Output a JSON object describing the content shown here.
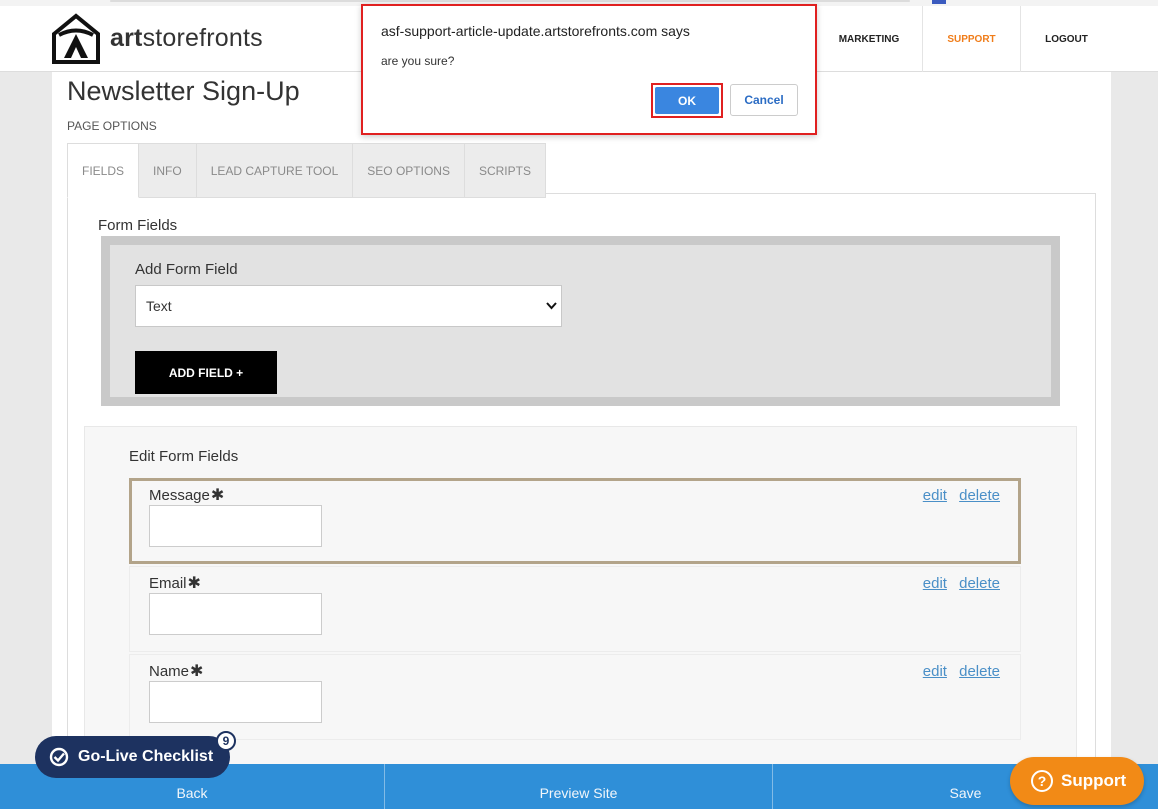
{
  "header": {
    "brand_bold": "art",
    "brand_rest": "storefronts",
    "nav": {
      "marketing": "MARKETING",
      "support": "SUPPORT",
      "logout": "LOGOUT"
    }
  },
  "page": {
    "title": "Newsletter Sign-Up",
    "options_label": "PAGE OPTIONS",
    "tabs": [
      "FIELDS",
      "INFO",
      "LEAD CAPTURE TOOL",
      "SEO OPTIONS",
      "SCRIPTS"
    ]
  },
  "form_fields": {
    "section_label": "Form Fields",
    "add_label": "Add Form Field",
    "select_value": "Text",
    "add_button": "ADD FIELD +"
  },
  "edit_fields": {
    "section_label": "Edit Form Fields",
    "rows": [
      {
        "name": "Message",
        "edit": "edit",
        "delete": "delete"
      },
      {
        "name": "Email",
        "edit": "edit",
        "delete": "delete"
      },
      {
        "name": "Name",
        "edit": "edit",
        "delete": "delete"
      }
    ],
    "required_mark": "✱"
  },
  "dialog": {
    "title": "asf-support-article-update.artstorefronts.com says",
    "message": "are you sure?",
    "ok": "OK",
    "cancel": "Cancel"
  },
  "bottom_bar": {
    "back": "Back",
    "preview": "Preview Site",
    "save": "Save"
  },
  "golive": {
    "label": "Go-Live Checklist",
    "badge": "9"
  },
  "support_widget": {
    "label": "Support",
    "icon_glyph": "?"
  },
  "colors": {
    "accent_orange": "#f07d1a",
    "bottom_bar": "#2f8fd8",
    "ok_button": "#3a86e0",
    "highlight_red": "#e02020",
    "golive_navy": "#1d3260"
  }
}
